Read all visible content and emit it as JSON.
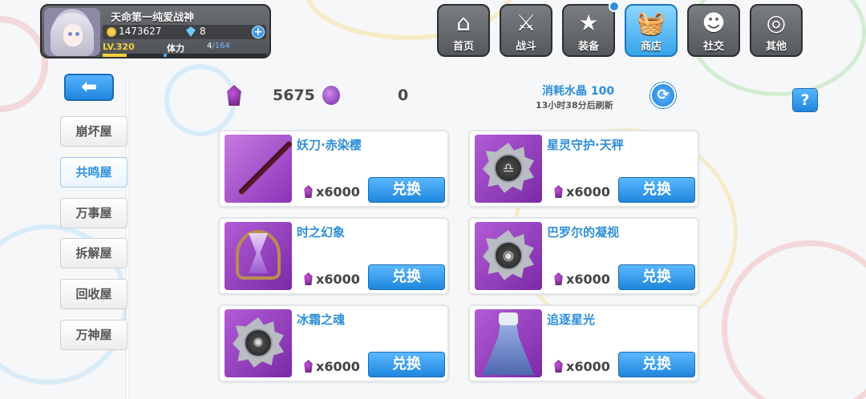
{
  "player": {
    "name": "天命第一纯爱战神",
    "coins": "1473627",
    "crystals": "8",
    "level": "LV.320",
    "stamina_label": "体力",
    "stamina_current": "4",
    "stamina_max": "/164",
    "level_progress": 0.4,
    "stamina_progress": 0.03
  },
  "nav": [
    {
      "label": "首页",
      "icon": "home-icon",
      "glyph": "⌂"
    },
    {
      "label": "战斗",
      "icon": "swords-icon",
      "glyph": "⚔"
    },
    {
      "label": "装备",
      "icon": "star-icon",
      "glyph": "★"
    },
    {
      "label": "商店",
      "icon": "shop-basket-icon",
      "glyph": "🧺"
    },
    {
      "label": "社交",
      "icon": "social-icon",
      "glyph": "☻"
    },
    {
      "label": "其他",
      "icon": "settings-icon",
      "glyph": "◎"
    }
  ],
  "side_menu": [
    {
      "label": "崩坏屋"
    },
    {
      "label": "共鸣屋"
    },
    {
      "label": "万事屋"
    },
    {
      "label": "拆解屋"
    },
    {
      "label": "回收屋"
    },
    {
      "label": "万神屋"
    }
  ],
  "currency": {
    "primary_amount": "5675",
    "secondary_amount": "0"
  },
  "refresh": {
    "cost_text": "消耗水晶 100",
    "time_text": "13小时38分后刷新"
  },
  "help_label": "?",
  "back_label": "⬅",
  "items": [
    {
      "name": "妖刀·赤染樱",
      "price": "x6000",
      "button": "兑换",
      "art": "sword"
    },
    {
      "name": "星灵守护·天秤",
      "price": "x6000",
      "button": "兑换",
      "art": "medal-libra"
    },
    {
      "name": "时之幻象",
      "price": "x6000",
      "button": "兑换",
      "art": "hourglass"
    },
    {
      "name": "巴罗尔的凝视",
      "price": "x6000",
      "button": "兑换",
      "art": "medal-eye"
    },
    {
      "name": "冰霜之魂",
      "price": "x6000",
      "button": "兑换",
      "art": "medal-frost"
    },
    {
      "name": "追逐星光",
      "price": "x6000",
      "button": "兑换",
      "art": "dress"
    }
  ],
  "colors": {
    "accent_blue": "#2f8fd8",
    "button_blue": "#1f86dc",
    "item_purple": "#7a2aa6",
    "level_yellow": "#f3d23b"
  }
}
